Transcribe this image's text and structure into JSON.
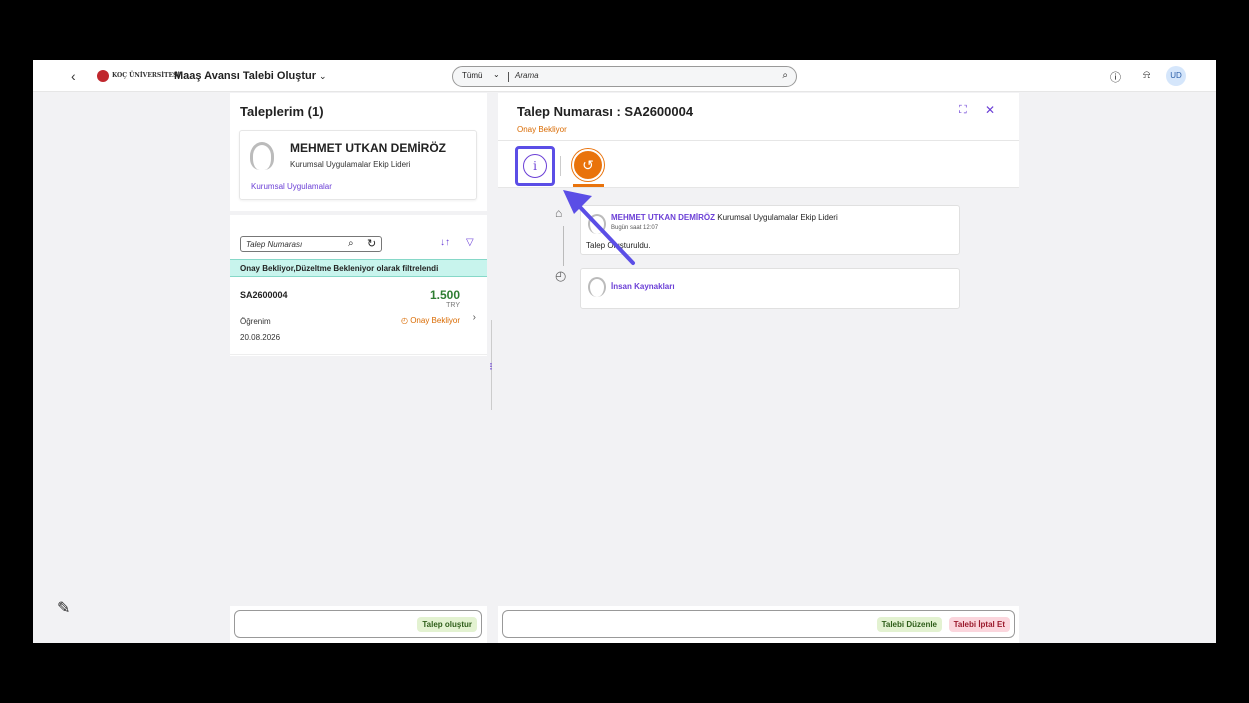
{
  "shell": {
    "back_icon": "chevron-left-icon",
    "logo_text": "KOÇ ÜNİVERSİTESİ",
    "app_title": "Maaş Avansı Talebi Oluştur",
    "search_scope": "Tümü",
    "search_placeholder": "Arama",
    "avatar_initials": "UD"
  },
  "left": {
    "title": "Taleplerim (1)",
    "employee": {
      "name": "MEHMET UTKAN DEMİRÖZ",
      "role": "Kurumsal Uygulamalar Ekip Lideri",
      "department": "Kurumsal Uygulamalar"
    },
    "search_placeholder": "Talep Numarası",
    "filter_info": "Onay Bekliyor,Düzeltme Bekleniyor olarak filtrelendi",
    "items": [
      {
        "number": "SA2600004",
        "amount": "1.500",
        "currency": "TRY",
        "type": "Öğrenim",
        "status": "Onay Bekliyor",
        "date": "20.08.2026"
      }
    ],
    "create_button": "Talep oluştur"
  },
  "right": {
    "title": "Talep Numarası : SA2600004",
    "status": "Onay Bekliyor",
    "timeline": [
      {
        "name": "MEHMET UTKAN DEMİRÖZ",
        "role": "Kurumsal Uygulamalar Ekip Lideri",
        "time": "Bugün saat 12:07",
        "text": "Talep Oluşturuldu."
      },
      {
        "name": "İnsan Kaynakları"
      }
    ],
    "edit_button": "Talebi Düzenle",
    "cancel_button": "Talebi İptal Et"
  },
  "colors": {
    "accent": "#6b3fd6",
    "warning": "#e9730c",
    "success": "#2e7d32",
    "filter_bar": "#c8f4ed"
  }
}
